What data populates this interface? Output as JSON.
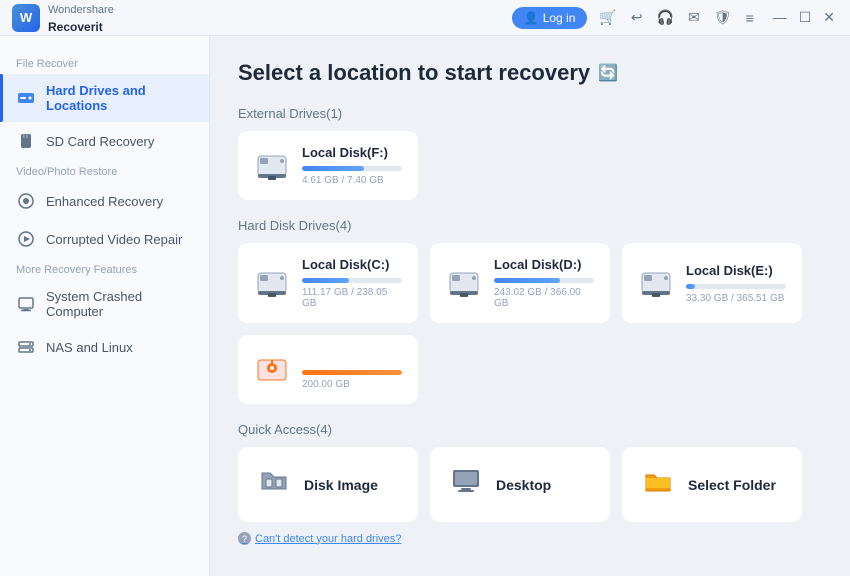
{
  "app": {
    "logo_text": "W",
    "brand_name": "Wondershare",
    "app_name": "Recoverit"
  },
  "titlebar": {
    "login_label": "Log in",
    "icons": [
      "🛒",
      "↩",
      "🎧",
      "✉",
      "🛡",
      "≡",
      "—",
      "☐",
      "✕"
    ]
  },
  "sidebar": {
    "section1_label": "File Recover",
    "section2_label": "Video/Photo Restore",
    "section3_label": "More Recovery Features",
    "items": [
      {
        "id": "hard-drives",
        "label": "Hard Drives and Locations",
        "active": true
      },
      {
        "id": "sd-card",
        "label": "SD Card Recovery",
        "active": false
      },
      {
        "id": "enhanced-recovery",
        "label": "Enhanced Recovery",
        "active": false
      },
      {
        "id": "corrupted-video",
        "label": "Corrupted Video Repair",
        "active": false
      },
      {
        "id": "system-crashed",
        "label": "System Crashed Computer",
        "active": false
      },
      {
        "id": "nas-linux",
        "label": "NAS and Linux",
        "active": false
      }
    ]
  },
  "content": {
    "page_title": "Select a location to start recovery",
    "external_drives_label": "External Drives(1)",
    "hard_disk_drives_label": "Hard Disk Drives(4)",
    "quick_access_label": "Quick Access(4)",
    "drives_external": [
      {
        "name": "Local Disk(F:)",
        "used": 4.61,
        "total": 7.4,
        "size_label": "4.61 GB / 7.40 GB",
        "progress": 62,
        "color": "blue"
      }
    ],
    "drives_hard": [
      {
        "name": "Local Disk(C:)",
        "used": 111.17,
        "total": 238.05,
        "size_label": "111.17 GB / 238.05 GB",
        "progress": 47,
        "color": "blue"
      },
      {
        "name": "Local Disk(D:)",
        "used": 243.02,
        "total": 366.0,
        "size_label": "243.02 GB / 366.00 GB",
        "progress": 66,
        "color": "blue"
      },
      {
        "name": "Local Disk(E:)",
        "used": 33.3,
        "total": 365.51,
        "size_label": "33.30 GB / 365.51 GB",
        "progress": 9,
        "color": "blue"
      },
      {
        "name": "",
        "used": 200,
        "total": 200,
        "size_label": "200.00 GB",
        "progress": 100,
        "color": "orange",
        "no_name": true
      }
    ],
    "quick_access": [
      {
        "id": "disk-image",
        "name": "Disk Image",
        "icon": "📂"
      },
      {
        "id": "desktop",
        "name": "Desktop",
        "icon": "🖥"
      },
      {
        "id": "select-folder",
        "name": "Select Folder",
        "icon": "📁"
      }
    ],
    "cant_detect_label": "Can't detect your hard drives?"
  }
}
